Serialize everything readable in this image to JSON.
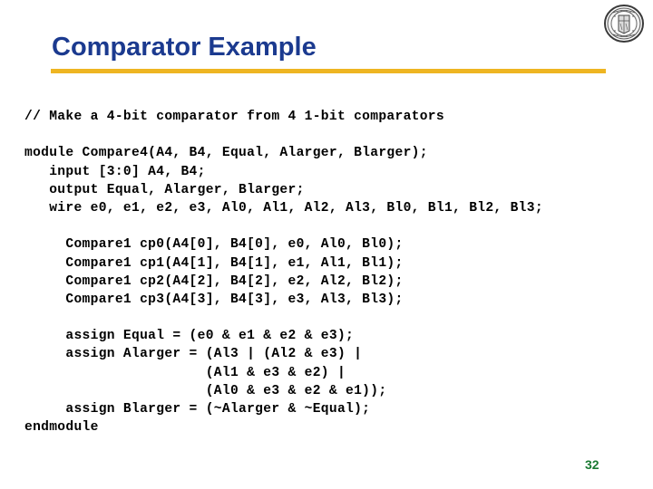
{
  "slide": {
    "title": "Comparator Example",
    "page_number": "32",
    "colors": {
      "title": "#1b3a8f",
      "rule": "#eeb522",
      "page_number": "#1a7a32",
      "code": "#000000",
      "background": "#ffffff"
    },
    "logo": {
      "name": "university-seal-logo",
      "description": "circular grayscale university seal"
    }
  },
  "code": {
    "language": "verilog",
    "lines": [
      "// Make a 4-bit comparator from 4 1-bit comparators",
      "",
      "module Compare4(A4, B4, Equal, Alarger, Blarger);",
      "   input [3:0] A4, B4;",
      "   output Equal, Alarger, Blarger;",
      "   wire e0, e1, e2, e3, Al0, Al1, Al2, Al3, Bl0, Bl1, Bl2, Bl3;",
      "",
      "     Compare1 cp0(A4[0], B4[0], e0, Al0, Bl0);",
      "     Compare1 cp1(A4[1], B4[1], e1, Al1, Bl1);",
      "     Compare1 cp2(A4[2], B4[2], e2, Al2, Bl2);",
      "     Compare1 cp3(A4[3], B4[3], e3, Al3, Bl3);",
      "",
      "     assign Equal = (e0 & e1 & e2 & e3);",
      "     assign Alarger = (Al3 | (Al2 & e3) |",
      "                      (Al1 & e3 & e2) |",
      "                      (Al0 & e3 & e2 & e1));",
      "     assign Blarger = (~Alarger & ~Equal);",
      "endmodule"
    ]
  }
}
